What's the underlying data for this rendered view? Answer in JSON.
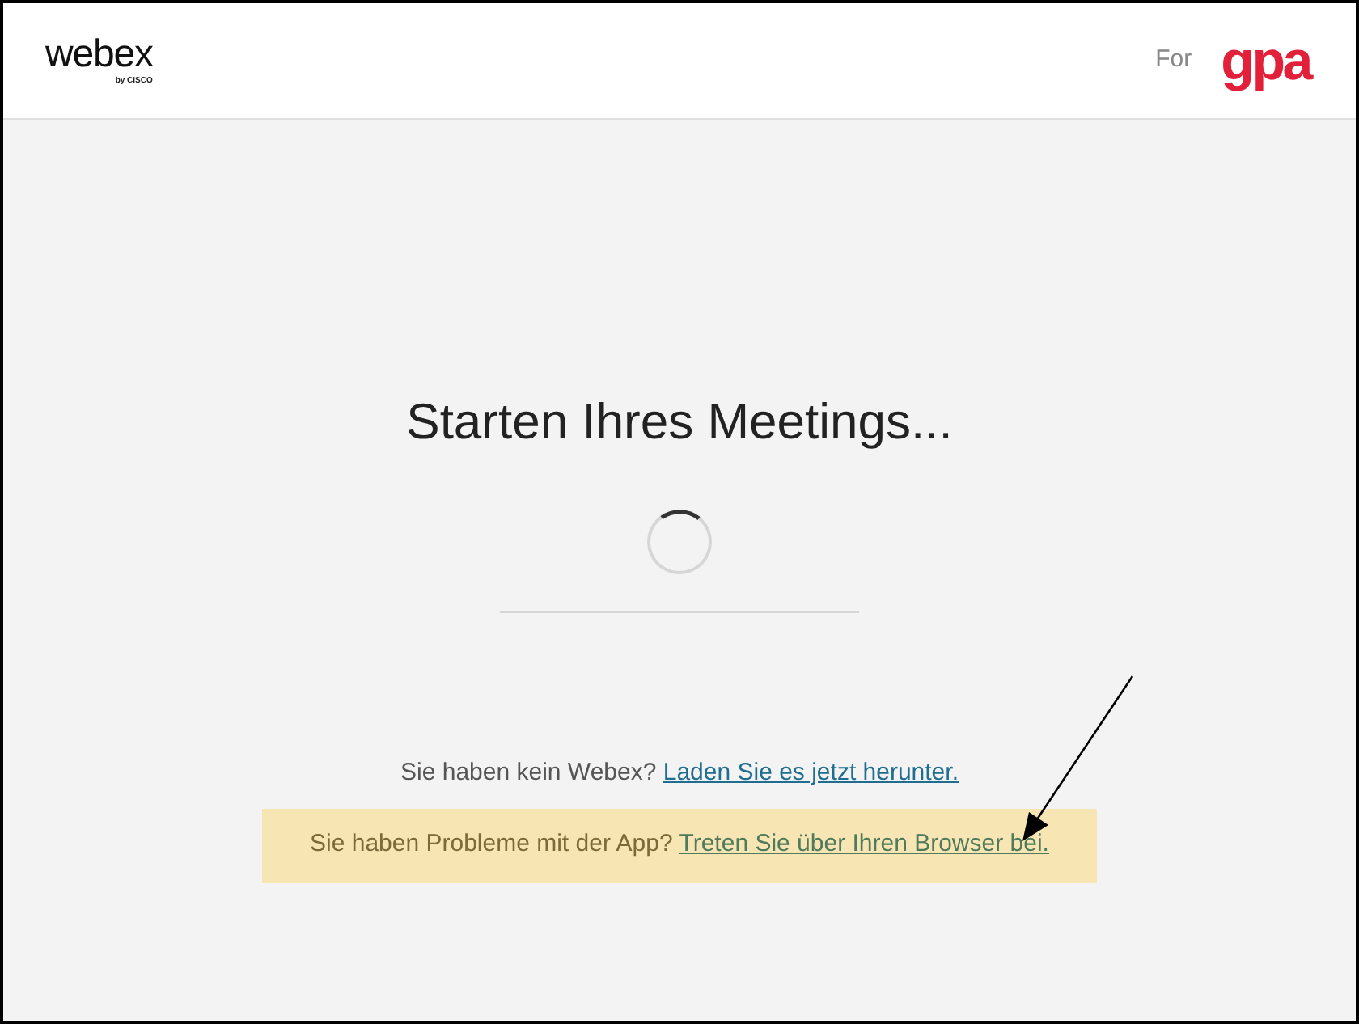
{
  "header": {
    "logo": "webex",
    "logo_byline": "by CISCO",
    "for_label": "For",
    "partner_logo": "gpa"
  },
  "main": {
    "title": "Starten Ihres Meetings...",
    "download_prompt": "Sie haben kein Webex?",
    "download_link": "Laden Sie es jetzt herunter.",
    "browser_prompt": "Sie haben Probleme mit der App?",
    "browser_link": "Treten Sie über Ihren Browser bei."
  }
}
